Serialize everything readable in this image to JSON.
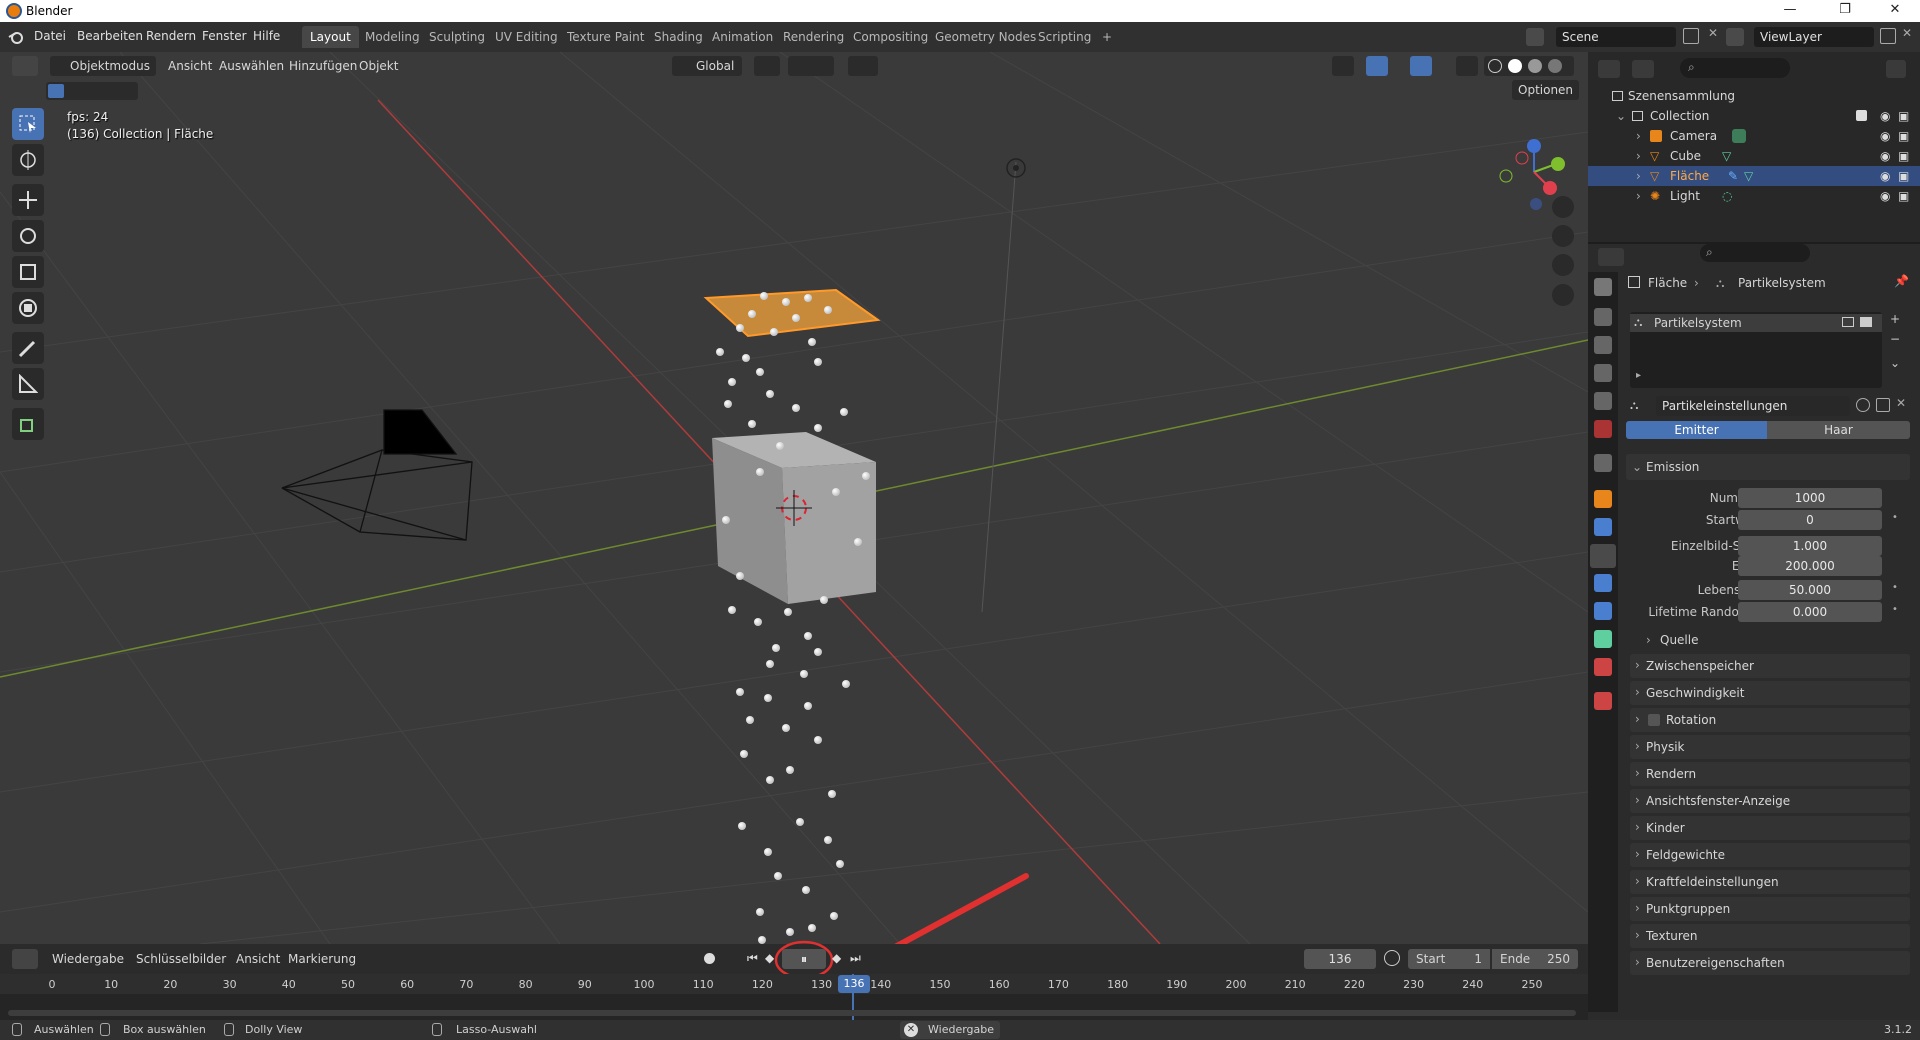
{
  "window": {
    "title": "Blender",
    "minimize": "—",
    "maximize": "❐",
    "close": "✕"
  },
  "menu": [
    "Datei",
    "Bearbeiten",
    "Rendern",
    "Fenster",
    "Hilfe"
  ],
  "workspaces": [
    "Layout",
    "Modeling",
    "Sculpting",
    "UV Editing",
    "Texture Paint",
    "Shading",
    "Animation",
    "Rendering",
    "Compositing",
    "Geometry Nodes",
    "Scripting"
  ],
  "workspace_add": "+",
  "scene": {
    "name": "Scene",
    "view_layer": "ViewLayer"
  },
  "viewport_header": {
    "mode": "Objektmodus",
    "menus": [
      "Ansicht",
      "Auswählen",
      "Hinzufügen",
      "Objekt"
    ],
    "transform_orientation": "Global",
    "options": "Optionen"
  },
  "viewport": {
    "fps": "fps: 24",
    "info": "(136) Collection | Fläche"
  },
  "outliner": {
    "root": "Szenensammlung",
    "collection": "Collection",
    "items": [
      {
        "name": "Camera",
        "icon": "camera-icon"
      },
      {
        "name": "Cube",
        "icon": "mesh-icon"
      },
      {
        "name": "Fläche",
        "icon": "mesh-icon",
        "selected": true
      },
      {
        "name": "Light",
        "icon": "light-icon"
      }
    ]
  },
  "properties": {
    "breadcrumb_object": "Fläche",
    "breadcrumb_sep": "›",
    "breadcrumb_system": "Partikelsystem",
    "particle_system": "Partikelsystem",
    "settings_name": "Partikeleinstellungen",
    "type_tabs": [
      "Emitter",
      "Haar"
    ],
    "active_type": "Emitter",
    "emission_title": "Emission",
    "fields": [
      {
        "label": "Nummer",
        "value": "1000"
      },
      {
        "label": "Startwert",
        "value": "0"
      },
      {
        "label": "Einzelbild-Start",
        "value": "1.000"
      },
      {
        "label": "Ende",
        "value": "200.000"
      },
      {
        "label": "Lebenszeit",
        "value": "50.000"
      },
      {
        "label": "Lifetime Random...",
        "value": "0.000"
      }
    ],
    "source": "Quelle",
    "panels": [
      "Zwischenspeicher",
      "Geschwindigkeit",
      "Rotation",
      "Physik",
      "Rendern",
      "Ansichtsfenster-Anzeige",
      "Kinder",
      "Feldgewichte",
      "Kraftfeldeinstellungen",
      "Punktgruppen",
      "Texturen",
      "Benutzereigenschaften"
    ]
  },
  "timeline": {
    "menus": [
      "Wiedergabe",
      "Schlüsselbilder",
      "Ansicht",
      "Markierung"
    ],
    "current_frame": "136",
    "start_label": "Start",
    "start": "1",
    "end_label": "Ende",
    "end": "250",
    "ticks": [
      "0",
      "10",
      "20",
      "30",
      "40",
      "50",
      "60",
      "70",
      "80",
      "90",
      "100",
      "110",
      "120",
      "130",
      "140",
      "150",
      "160",
      "170",
      "180",
      "190",
      "200",
      "210",
      "220",
      "230",
      "240",
      "250"
    ]
  },
  "statusbar": {
    "items": [
      "Auswählen",
      "Box auswählen",
      "Dolly View",
      "Lasso-Auswahl"
    ],
    "playback": "Wiedergabe",
    "version": "3.1.2"
  },
  "colors": {
    "accent": "#4772b3",
    "selection": "#e8851b",
    "annotation": "#e03030"
  }
}
